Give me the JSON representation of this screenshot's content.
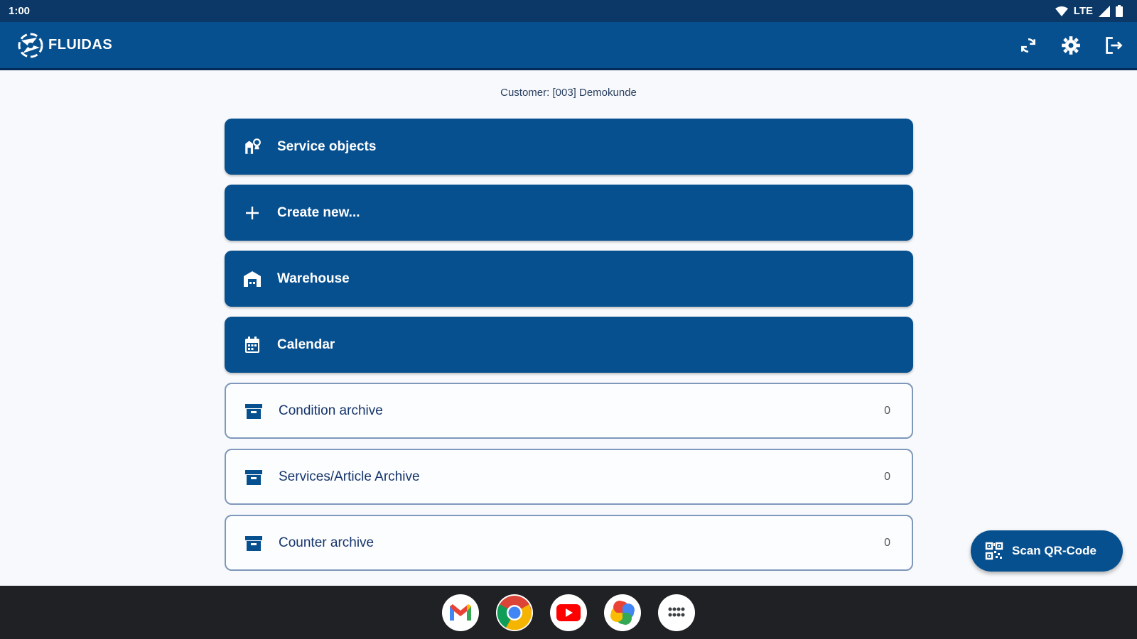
{
  "status_bar": {
    "time": "1:00",
    "network": "LTE"
  },
  "app_bar": {
    "logo_text": "FLUIDAS",
    "icons": [
      "sync-icon",
      "settings-icon",
      "logout-icon"
    ]
  },
  "customer_label": "Customer: [003] Demokunde",
  "menu": {
    "items": [
      {
        "label": "Service objects",
        "icon": "service-objects-icon",
        "style": "filled"
      },
      {
        "label": "Create new...",
        "icon": "plus-icon",
        "style": "filled"
      },
      {
        "label": "Warehouse",
        "icon": "warehouse-icon",
        "style": "filled"
      },
      {
        "label": "Calendar",
        "icon": "calendar-icon",
        "style": "filled"
      },
      {
        "label": "Condition archive",
        "icon": "archive-icon",
        "style": "outlined",
        "count": "0"
      },
      {
        "label": "Services/Article Archive",
        "icon": "archive-icon",
        "style": "outlined",
        "count": "0"
      },
      {
        "label": "Counter archive",
        "icon": "archive-icon",
        "style": "outlined",
        "count": "0"
      }
    ]
  },
  "fab": {
    "label": "Scan QR-Code",
    "icon": "qr-code-icon"
  },
  "dock": {
    "apps": [
      "gmail-icon",
      "chrome-icon",
      "youtube-icon",
      "photos-icon",
      "app-drawer-icon"
    ]
  },
  "colors": {
    "primary": "#07508f",
    "status_bar": "#0b3866",
    "outline": "#7f97bb",
    "taskbar": "#202124"
  }
}
